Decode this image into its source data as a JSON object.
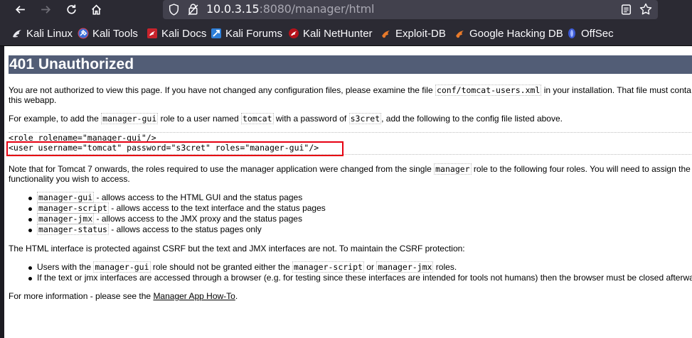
{
  "browser": {
    "url_host": "10.0.3.15",
    "url_rest": ":8080/manager/html",
    "bookmarks": [
      {
        "label": "Kali Linux",
        "icon": "kali-dragon-icon"
      },
      {
        "label": "Kali Tools",
        "icon": "kali-tools-icon"
      },
      {
        "label": "Kali Docs",
        "icon": "kali-docs-icon"
      },
      {
        "label": "Kali Forums",
        "icon": "kali-forums-icon"
      },
      {
        "label": "Kali NetHunter",
        "icon": "kali-nethunter-icon"
      },
      {
        "label": "Exploit-DB",
        "icon": "exploit-db-icon"
      },
      {
        "label": "Google Hacking DB",
        "icon": "ghdb-icon"
      },
      {
        "label": "OffSec",
        "icon": "offsec-icon"
      }
    ]
  },
  "page": {
    "heading": "401 Unauthorized",
    "p1_a": "You are not authorized to view this page. If you have not changed any configuration files, please examine the file ",
    "p1_code": "conf/tomcat-users.xml",
    "p1_b": " in your installation. That file must conta",
    "p1_line2": "this webapp.",
    "p2_a": "For example, to add the ",
    "p2_role": "manager-gui",
    "p2_b": " role to a user named ",
    "p2_user": "tomcat",
    "p2_c": " with a password of ",
    "p2_pass": "s3cret",
    "p2_d": ", add the following to the config file listed above.",
    "pre_line1": "<role rolename=\"manager-gui\"/>",
    "pre_line2": "<user username=\"tomcat\" password=\"s3cret\" roles=\"manager-gui\"/>",
    "p3_a": "Note that for Tomcat 7 onwards, the roles required to use the manager application were changed from the single ",
    "p3_code": "manager",
    "p3_b": " role to the following four roles. You will need to assign the",
    "p3_line2": "functionality you wish to access.",
    "roles": [
      {
        "code": "manager-gui",
        "text": " - allows access to the HTML GUI and the status pages"
      },
      {
        "code": "manager-script",
        "text": " - allows access to the text interface and the status pages"
      },
      {
        "code": "manager-jmx",
        "text": " - allows access to the JMX proxy and the status pages"
      },
      {
        "code": "manager-status",
        "text": " - allows access to the status pages only"
      }
    ],
    "p4": "The HTML interface is protected against CSRF but the text and JMX interfaces are not. To maintain the CSRF protection:",
    "csrf1_a": "Users with the ",
    "csrf1_c1": "manager-gui",
    "csrf1_b": " role should not be granted either the ",
    "csrf1_c2": "manager-script",
    "csrf1_c": " or ",
    "csrf1_c3": "manager-jmx",
    "csrf1_d": " roles.",
    "csrf2": "If the text or jmx interfaces are accessed through a browser (e.g. for testing since these interfaces are intended for tools not humans) then the browser must be closed afterwa",
    "p5_a": "For more information - please see the ",
    "p5_link": "Manager App How-To",
    "p5_b": "."
  },
  "colors": {
    "heading_bg": "#525d76",
    "highlight_border": "#e60012",
    "chrome_bg": "#2b2a33",
    "urlbar_bg": "#42414d"
  }
}
